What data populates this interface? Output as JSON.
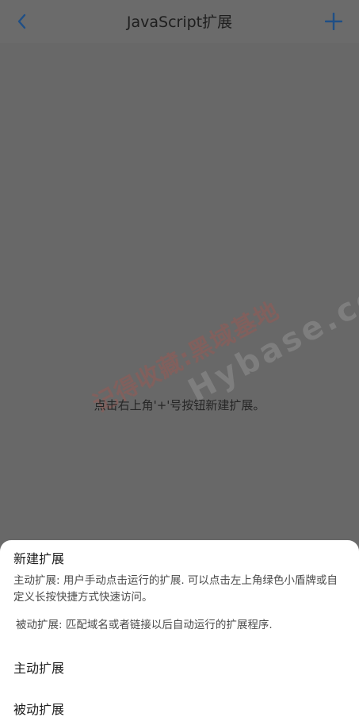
{
  "header": {
    "title": "JavaScript扩展",
    "back_icon": "chevron-left-icon",
    "add_icon": "plus-icon",
    "accent_color": "#1f4f86"
  },
  "main": {
    "empty_hint": "点击右上角'+'号按钮新建扩展。"
  },
  "watermark": {
    "cn_text": "记得收藏:黑域基地",
    "en_text": "Hybase.com"
  },
  "sheet": {
    "title": "新建扩展",
    "active_desc": "主动扩展: 用户手动点击运行的扩展. 可以点击左上角绿色小盾牌或自定义长按快捷方式快速访问。",
    "passive_desc": "被动扩展: 匹配域名或者链接以后自动运行的扩展程序.",
    "option_active": "主动扩展",
    "option_passive": "被动扩展"
  }
}
